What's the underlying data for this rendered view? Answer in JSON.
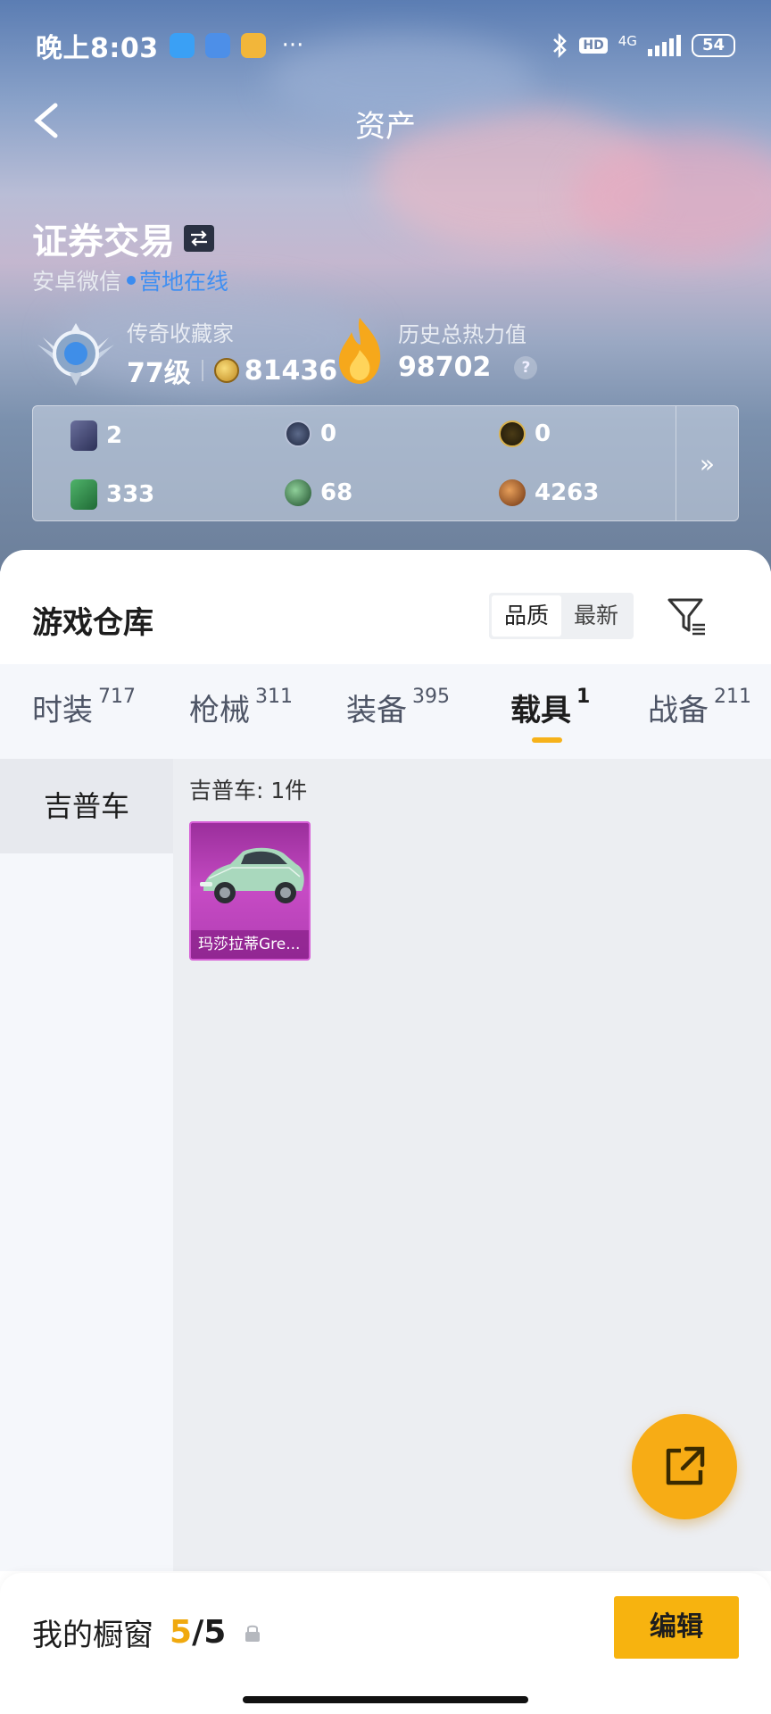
{
  "status_bar": {
    "time": "晚上8:03",
    "dots": "···",
    "network": "4G",
    "hd": "HD",
    "battery": "54"
  },
  "nav": {
    "title": "资产"
  },
  "profile": {
    "name": "证券交易",
    "platform": "安卓微信",
    "online": "营地在线",
    "rank_label": "传奇收藏家",
    "level": "77级",
    "points": "81436",
    "heat_label": "历史总热力值",
    "heat_value": "98702",
    "help": "?"
  },
  "resources": [
    {
      "icon": "card-icon",
      "value": "2"
    },
    {
      "icon": "silver-medal-icon",
      "value": "0"
    },
    {
      "icon": "gold-medal-icon",
      "value": "0"
    },
    {
      "icon": "green-card-icon",
      "value": "333"
    },
    {
      "icon": "green-orb-icon",
      "value": "68"
    },
    {
      "icon": "bronze-coin-icon",
      "value": "4263"
    }
  ],
  "resources_more": "»",
  "warehouse": {
    "title": "游戏仓库",
    "sort_options": [
      "品质",
      "最新"
    ],
    "sort_selected": "品质"
  },
  "tabs": [
    {
      "label": "时装",
      "count": "717"
    },
    {
      "label": "枪械",
      "count": "311"
    },
    {
      "label": "装备",
      "count": "395"
    },
    {
      "label": "载具",
      "count": "1"
    },
    {
      "label": "战备",
      "count": "211"
    }
  ],
  "active_tab": "载具",
  "category": {
    "name": "吉普车",
    "group_label": "吉普车: 1件"
  },
  "items": [
    {
      "name": "玛莎拉蒂Gre..."
    }
  ],
  "footer": {
    "title": "我的橱窗",
    "used": "5",
    "slash": "/",
    "total": "5",
    "edit_label": "编辑"
  },
  "colors": {
    "accent": "#f7b30f",
    "online": "#3f8ff2",
    "card_purple": "#c64bc4"
  }
}
